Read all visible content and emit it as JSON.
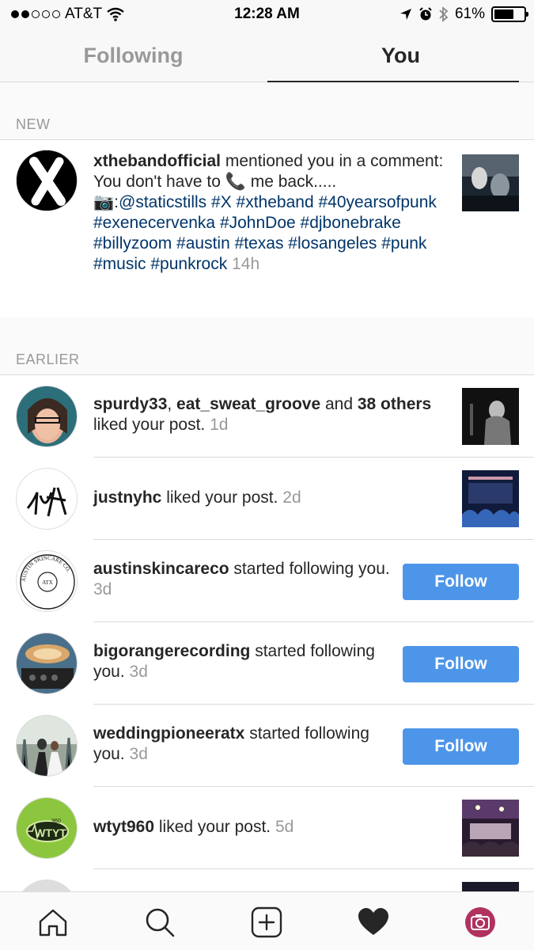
{
  "status_bar": {
    "carrier": "AT&T",
    "time": "12:28 AM",
    "battery": "61%",
    "battery_level": 0.61
  },
  "tabs": [
    {
      "label": "Following",
      "active": false
    },
    {
      "label": "You",
      "active": true
    }
  ],
  "sections": {
    "new": "NEW",
    "earlier": "EARLIER"
  },
  "new_item": {
    "username": "xthebandofficial",
    "text_1": " mentioned you in a comment: You don't have to ",
    "phone_emoji": "📞",
    "text_2": " me back..... ",
    "camera_emoji": "📷",
    "text_3": ":",
    "mention": "@staticstills",
    "tags": "#X #xtheband #40yearsofpunk #exenecervenka #JohnDoe #djbonebrake #billyzoom #austin #texas #losangeles #punk #music #punkrock",
    "time": "14h"
  },
  "earlier": [
    {
      "users": "spurdy33",
      "sep": ", ",
      "user2": "eat_sweat_groove",
      "and": " and ",
      "count": "38 others",
      "action": " liked your post. ",
      "time": "1d"
    },
    {
      "users": "justnyhc",
      "action": " liked your post. ",
      "time": "2d"
    },
    {
      "users": "austinskincareco",
      "action": " started following you. ",
      "time": "3d",
      "button": "Follow",
      "avatar_text": "AUSTIN SKINCARE CO.",
      "avatar_center": "ATX"
    },
    {
      "users": "bigorangerecording",
      "action": " started following you. ",
      "time": "3d",
      "button": "Follow"
    },
    {
      "users": "weddingpioneeratx",
      "action": " started following you. ",
      "time": "3d",
      "button": "Follow"
    },
    {
      "users": "wtyt960",
      "action": " liked your post. ",
      "time": "5d",
      "avatar_text": "WTYT",
      "avatar_small": "960"
    }
  ],
  "icons": {
    "home": "home-icon",
    "search": "search-icon",
    "add": "add-post-icon",
    "activity": "heart-icon",
    "profile": "profile-camera-icon"
  },
  "colors": {
    "follow_button": "#4d95e8",
    "hashtag": "#003569",
    "profile_avatar": "#b0325f"
  }
}
